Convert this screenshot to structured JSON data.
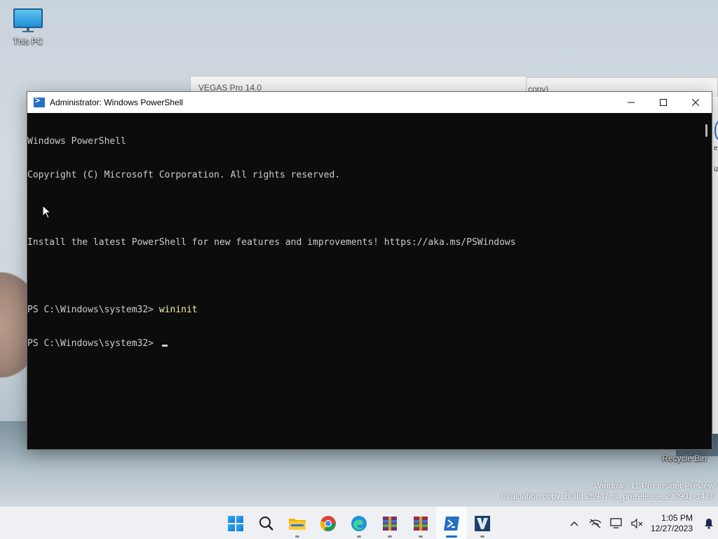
{
  "desktop": {
    "icons": [
      {
        "label": "This PC"
      },
      {
        "label": "Recycle Bin"
      }
    ],
    "watermark": {
      "line1": "Windows 11 Pro Insider Preview",
      "line2": "Evaluation copy. Build 25947.rs_prerelease.230901-1416"
    }
  },
  "background_windows": {
    "vegas_title": "VEGAS Pro 14.0",
    "vegas_second_fragment": "copy)",
    "right_strip_fragment_1": "e",
    "right_strip_fragment_2": "iz"
  },
  "powershell": {
    "title": "Administrator: Windows PowerShell",
    "controls": {
      "minimize": "—",
      "maximize": "☐",
      "close": "✕"
    },
    "lines": [
      "Windows PowerShell",
      "Copyright (C) Microsoft Corporation. All rights reserved.",
      "",
      "Install the latest PowerShell for new features and improvements! https://aka.ms/PSWindows",
      ""
    ],
    "prompt_1": "PS C:\\Windows\\system32> ",
    "command_1": "wininit",
    "prompt_2": "PS C:\\Windows\\system32> "
  },
  "taskbar": {
    "apps": [
      {
        "name": "start",
        "running": false
      },
      {
        "name": "search",
        "running": false
      },
      {
        "name": "file-explorer",
        "running": true
      },
      {
        "name": "chrome",
        "running": false
      },
      {
        "name": "edge",
        "running": true
      },
      {
        "name": "winrar",
        "running": true
      },
      {
        "name": "winrar-2",
        "running": true
      },
      {
        "name": "powershell",
        "running": true,
        "active": true
      },
      {
        "name": "vegas-pro",
        "running": true
      }
    ],
    "clock": {
      "time": "1:05 PM",
      "date": "12/27/2023"
    },
    "tray": {
      "overflow": "^"
    }
  },
  "colors": {
    "console_bg": "#0c0c0c",
    "console_fg": "#cccccc",
    "command_color": "#f9f1a5",
    "accent": "#0a6fd0"
  }
}
